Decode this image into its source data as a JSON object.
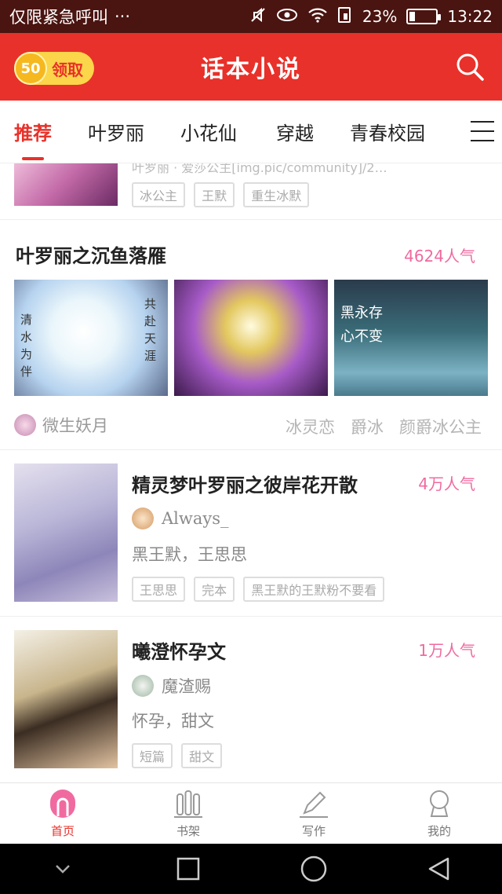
{
  "status_bar": {
    "notification_text": "仅限紧急呼叫",
    "more": "···",
    "battery": "23%",
    "battery_level": 0.23,
    "time": "13:22"
  },
  "header": {
    "coin_value": "50",
    "claim_label": "领取",
    "title": "话本小说",
    "accent_color": "#e8312a"
  },
  "tabs": [
    {
      "label": "推荐"
    },
    {
      "label": "叶罗丽"
    },
    {
      "label": "小花仙"
    },
    {
      "label": "穿越"
    },
    {
      "label": "青春校园"
    }
  ],
  "partial_item": {
    "title_fragment": "叶罗丽 · 爱莎公主[img.pic/community]/2…",
    "tags": [
      "冰公主",
      "王默",
      "重生冰默"
    ]
  },
  "group_card": {
    "title": "叶罗丽之沉鱼落雁",
    "popularity": "4624人气",
    "image1_text_left": "清水为伴",
    "image1_text_right": "共赴天涯",
    "image3_text": [
      "黑永存",
      "心不变"
    ],
    "author": "微生妖月",
    "tags": [
      "冰灵恋",
      "爵冰",
      "颜爵冰公主"
    ]
  },
  "books": [
    {
      "title": "精灵梦叶罗丽之彼岸花开散",
      "popularity": "4万人气",
      "author": "Always_",
      "description": "黑王默，王思思",
      "tags": [
        "王思思",
        "完本",
        "黑王默的王默粉不要看"
      ]
    },
    {
      "title": "曦澄怀孕文",
      "popularity": "1万人气",
      "author": "魔渣赐",
      "description": "怀孕，甜文",
      "tags": [
        "短篇",
        "甜文"
      ]
    }
  ],
  "bottom_nav": [
    {
      "label": "首页",
      "icon": "home-icon",
      "active": true
    },
    {
      "label": "书架",
      "icon": "bookshelf-icon",
      "active": false
    },
    {
      "label": "写作",
      "icon": "pen-icon",
      "active": false
    },
    {
      "label": "我的",
      "icon": "profile-icon",
      "active": false
    }
  ]
}
